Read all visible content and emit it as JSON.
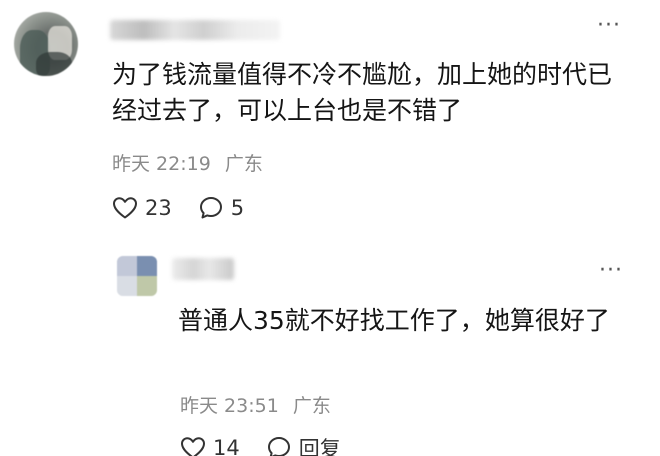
{
  "comment": {
    "avatar_icon": "user-avatar-blurred",
    "username_blurred": true,
    "more_label": "···",
    "text": "为了钱流量值得不冷不尴尬，加上她的时代已经过去了，可以上台也是不错了",
    "time": "昨天 22:19",
    "location": "广东",
    "likes": "23",
    "replies": "5"
  },
  "reply": {
    "avatar_icon": "user-avatar-blurred",
    "username_blurred": true,
    "more_label": "···",
    "text": "普通人35就不好找工作了，她算很好了",
    "time": "昨天 23:51",
    "location": "广东",
    "likes": "14",
    "reply_label": "回复"
  },
  "colors": {
    "text": "#151515",
    "meta": "#8a8a8a",
    "icon": "#333333"
  }
}
